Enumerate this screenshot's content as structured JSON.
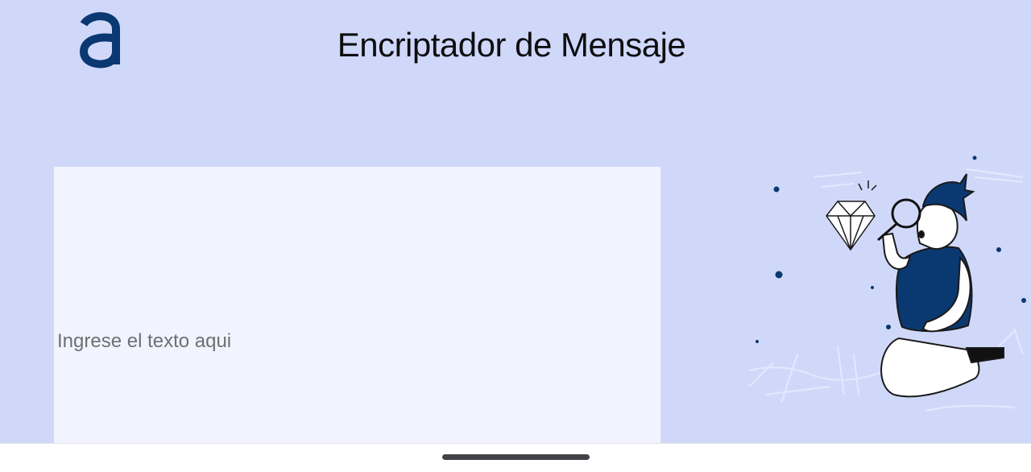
{
  "app": {
    "title": "Encriptador de Mensaje",
    "logo_icon": "alura-a-logo-icon",
    "accent_color": "#0a3871",
    "background_color": "#d0d8fa"
  },
  "input": {
    "value": "",
    "placeholder": "Ingrese el texto aqui"
  },
  "illustration": {
    "icon": "person-with-magnifier-and-diamond-illustration"
  },
  "system": {
    "home_indicator": "home-indicator"
  }
}
